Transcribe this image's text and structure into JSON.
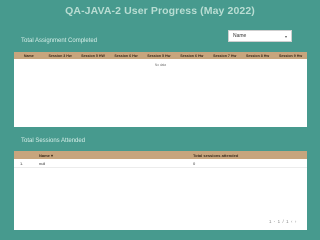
{
  "page": {
    "title": "QA-JAVA-2 User Progress (May 2022)"
  },
  "filter": {
    "selected": "Name",
    "caret": "▾"
  },
  "assignments": {
    "label": "Total Assignment Completed",
    "columns": [
      "Name",
      "Session 3 Hw",
      "Session 5 HW",
      "Session 6 Hw",
      "Session 5 Hw",
      "Session 6 Hw",
      "Session 7 Hw",
      "Session 8 Hw",
      "Session 9 Hw"
    ],
    "empty_text": "No data"
  },
  "sessions": {
    "label": "Total Sessions Attended",
    "columns": {
      "name": "Name",
      "name_sort": "▾",
      "total": "Total sessions attended"
    },
    "rows": [
      {
        "index": "1.",
        "name": "null",
        "total": "0"
      }
    ],
    "pager": "1 - 1 / 1   ‹   ›"
  }
}
